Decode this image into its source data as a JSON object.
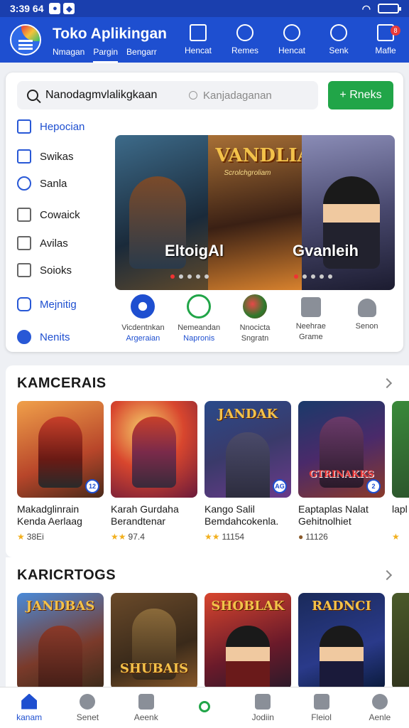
{
  "status_bar": {
    "time": "3:39 64"
  },
  "header": {
    "title": "Toko Aplikingan",
    "tabs": [
      "Nmagan",
      "Pargin",
      "Bengarr"
    ],
    "actions": [
      {
        "label": "Hencat",
        "icon": "bookmark-icon"
      },
      {
        "label": "Remes",
        "icon": "gamepad-icon"
      },
      {
        "label": "Hencat",
        "icon": "info-icon"
      },
      {
        "label": "Senk",
        "icon": "search-icon"
      },
      {
        "label": "Mafle",
        "icon": "menu-icon",
        "badge": "8"
      }
    ]
  },
  "search": {
    "value": "Nanodagmvlalikgkaan",
    "secondary": "Kanjadaganan",
    "button_label": "+ Rneks"
  },
  "side_menu": [
    {
      "label": "Hepocian",
      "icon": "window-icon"
    },
    {
      "label": "Swikas",
      "icon": "folder-icon"
    },
    {
      "label": "Sanla",
      "icon": "puzzle-icon"
    },
    {
      "label": "Cowaick",
      "icon": "gauge-icon"
    },
    {
      "label": "Avilas",
      "icon": "document-icon"
    },
    {
      "label": "Soioks",
      "icon": "box-icon"
    },
    {
      "label": "Mejnitig",
      "icon": "eye-icon"
    },
    {
      "label": "Nenits",
      "icon": "apps-icon"
    }
  ],
  "banner": {
    "logo": "VANDLIAN",
    "logo_sub": "Scrolchgroliam",
    "caption_left": "EltoigAl",
    "caption_right": "Gvanleih"
  },
  "quick_links": [
    {
      "label": "Vicdentnkan",
      "sub": "Argeraian",
      "icon": "pause-circle-icon"
    },
    {
      "label": "Nemeandan",
      "sub": "Napronis",
      "icon": "compass-icon"
    },
    {
      "label": "Nnocicta",
      "sub": "Sngratn",
      "icon": "food-icon"
    },
    {
      "label": "Neehrae",
      "sub": "Grame",
      "icon": "grid-icon"
    },
    {
      "label": "Senon",
      "sub": "",
      "icon": "person-icon"
    }
  ],
  "sections": [
    {
      "title": "KAMCERAIS",
      "apps": [
        {
          "name": "Makadglinrain Kenda Aerlaag",
          "rating": "38Ei",
          "logo": ""
        },
        {
          "name": "Karah Gurdaha Berandtenar",
          "rating": "97.4",
          "logo": ""
        },
        {
          "name": "Kango Salil Bemdahcokenla.",
          "rating": "11154",
          "logo": "JANDAK"
        },
        {
          "name": "Eaptaplas Nalat Gehitnolhiet",
          "rating": "11126",
          "logo": "GTRINAKKS"
        },
        {
          "name": "lapl Uar",
          "rating": "",
          "logo": ""
        }
      ]
    },
    {
      "title": "KARICRTOGS",
      "apps": [
        {
          "name": "",
          "rating": "",
          "logo": "JANDBAS"
        },
        {
          "name": "",
          "rating": "",
          "logo": "SHUBAIS"
        },
        {
          "name": "",
          "rating": "",
          "logo": "SHOBLAK"
        },
        {
          "name": "",
          "rating": "",
          "logo": "RADNCI"
        },
        {
          "name": "",
          "rating": "",
          "logo": ""
        }
      ]
    }
  ],
  "bottom_nav": [
    {
      "label": "kanam",
      "icon": "home-icon"
    },
    {
      "label": "Senet",
      "icon": "compass-icon"
    },
    {
      "label": "Aeenk",
      "icon": "star-badge-icon"
    },
    {
      "label": "",
      "icon": "search-icon"
    },
    {
      "label": "Jodiin",
      "icon": "image-icon"
    },
    {
      "label": "Fleiol",
      "icon": "list-icon"
    },
    {
      "label": "Aenle",
      "icon": "person-icon"
    }
  ],
  "colors": {
    "primary": "#1e4fd0",
    "accent": "#21a548",
    "badge": "#e83a3a"
  }
}
